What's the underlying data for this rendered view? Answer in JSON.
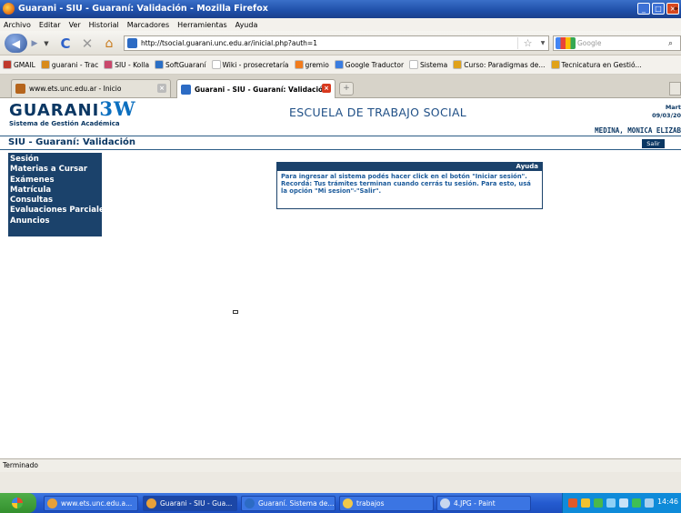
{
  "window": {
    "title": "Guarani - SIU - Guaraní: Validación - Mozilla Firefox"
  },
  "menubar": [
    "Archivo",
    "Editar",
    "Ver",
    "Historial",
    "Marcadores",
    "Herramientas",
    "Ayuda"
  ],
  "navbar": {
    "url": "http://tsocial.guarani.unc.edu.ar/inicial.php?auth=1",
    "search_placeholder": "Google"
  },
  "bookmarks": [
    {
      "label": "GMAIL",
      "color": "#c0392b"
    },
    {
      "label": "guarani - Trac",
      "color": "#d88a1a"
    },
    {
      "label": "SIU - Kolla",
      "color": "#c9486b"
    },
    {
      "label": "SoftGuaraní",
      "color": "#2b6fc5"
    },
    {
      "label": "Wiki - prosecretaría",
      "color": "#ffffff"
    },
    {
      "label": "gremio",
      "color": "#f27c1c"
    },
    {
      "label": "Google Traductor",
      "color": "#3a7de0"
    },
    {
      "label": "Sistema",
      "color": "#ffffff"
    },
    {
      "label": "Curso: Paradigmas de...",
      "color": "#e0a21a"
    },
    {
      "label": "Tecnicatura en Gestió...",
      "color": "#e0a21a"
    }
  ],
  "tabs": [
    {
      "label": "www.ets.unc.edu.ar - Inicio",
      "color": "#b5651d"
    },
    {
      "label": "Guarani - SIU - Guaraní: Validación",
      "color": "#2c6bc4"
    }
  ],
  "page": {
    "logo": "GUARANI",
    "logo_suffix": "3W",
    "logo_subtitle": "Sistema de Gestión Académica",
    "school": "ESCUELA DE TRABAJO SOCIAL",
    "date_day": "Mart",
    "date": "09/03/20",
    "user": "MEDINA, MONICA ELIZAB",
    "title": "SIU - Guaraní: Validación",
    "logout": "Salir",
    "menu": [
      "Sesión",
      "Materias a Cursar",
      "Exámenes",
      "Matrícula",
      "Consultas",
      "Evaluaciones Parciales",
      "Anuncios"
    ],
    "help": {
      "title": "Ayuda",
      "text": "Para ingresar al sistema podés hacer click en el botón \"Iniciar sesión\". Recordá: Tus trámites terminan cuando cerrás tu sesión. Para esto, usá la opción \"Mi sesion\"-\"Salir\"."
    }
  },
  "status": "Terminado",
  "taskbar": {
    "items": [
      {
        "label": "www.ets.unc.edu.a...",
        "color": "#e8a13a"
      },
      {
        "label": "Guarani - SIU - Gua...",
        "color": "#e8a13a"
      },
      {
        "label": "Guaraní. Sistema de...",
        "color": "#2c6bc4"
      },
      {
        "label": "trabajos",
        "color": "#f0c84a"
      },
      {
        "label": "4.JPG - Paint",
        "color": "#c8d7ee"
      }
    ],
    "clock": "14:46"
  }
}
